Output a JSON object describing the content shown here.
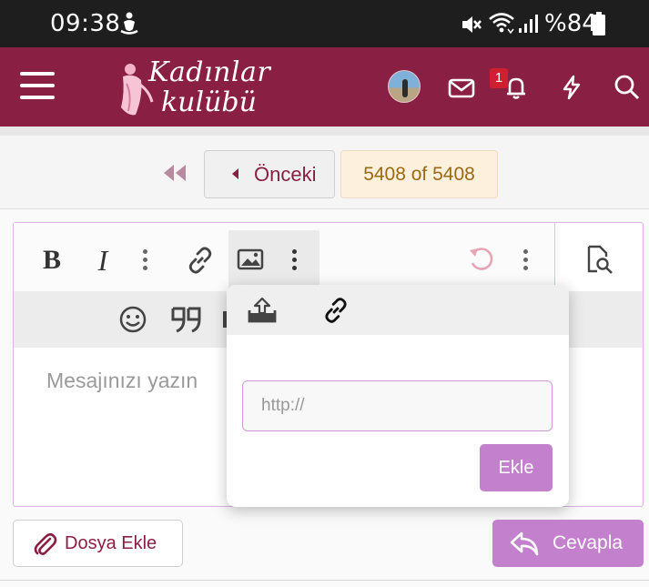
{
  "status_bar": {
    "time": "09:38",
    "battery": "%84"
  },
  "header": {
    "logo_line1": "Kadınlar",
    "logo_line2": "kulübü",
    "notification_count": "1"
  },
  "pagination": {
    "prev_label": "Önceki",
    "page_count": "5408 of 5408"
  },
  "editor": {
    "bold_label": "B",
    "italic_label": "I",
    "placeholder": "Mesajınızı yazın"
  },
  "image_popup": {
    "url_placeholder": "http://",
    "add_label": "Ekle"
  },
  "footer": {
    "attach_label": "Dosya Ekle",
    "reply_label": "Cevapla"
  },
  "colors": {
    "brand": "#8a1f44",
    "accent": "#c381cd",
    "badge": "#d0202f"
  }
}
